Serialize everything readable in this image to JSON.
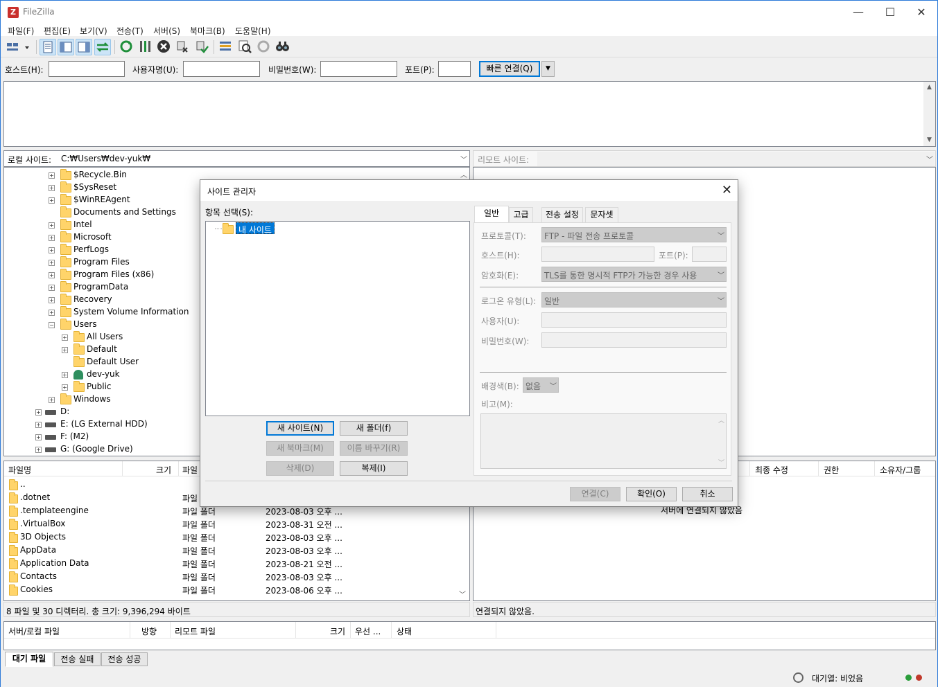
{
  "window": {
    "title": "FileZilla",
    "min": "—",
    "max": "☐",
    "close": "✕"
  },
  "menu": [
    "파일(F)",
    "편집(E)",
    "보기(V)",
    "전송(T)",
    "서버(S)",
    "북마크(B)",
    "도움말(H)"
  ],
  "quickconnect": {
    "host_label": "호스트(H):",
    "user_label": "사용자명(U):",
    "pass_label": "비밀번호(W):",
    "port_label": "포트(P):",
    "host_value": "",
    "user_value": "",
    "pass_value": "",
    "port_value": "",
    "connect_button": "빠른 연결(Q)"
  },
  "local": {
    "site_label": "로컬 사이트:",
    "path": "C:₩Users₩dev-yuk₩",
    "tree": [
      {
        "label": "$Recycle.Bin",
        "indent": 3,
        "exp": "+",
        "icon": "folder"
      },
      {
        "label": "$SysReset",
        "indent": 3,
        "exp": "+",
        "icon": "folder"
      },
      {
        "label": "$WinREAgent",
        "indent": 3,
        "exp": "+",
        "icon": "folder"
      },
      {
        "label": "Documents and Settings",
        "indent": 3,
        "exp": "",
        "icon": "folder"
      },
      {
        "label": "Intel",
        "indent": 3,
        "exp": "+",
        "icon": "folder"
      },
      {
        "label": "Microsoft",
        "indent": 3,
        "exp": "+",
        "icon": "folder"
      },
      {
        "label": "PerfLogs",
        "indent": 3,
        "exp": "+",
        "icon": "folder"
      },
      {
        "label": "Program Files",
        "indent": 3,
        "exp": "+",
        "icon": "folder"
      },
      {
        "label": "Program Files (x86)",
        "indent": 3,
        "exp": "+",
        "icon": "folder"
      },
      {
        "label": "ProgramData",
        "indent": 3,
        "exp": "+",
        "icon": "folder"
      },
      {
        "label": "Recovery",
        "indent": 3,
        "exp": "+",
        "icon": "folder"
      },
      {
        "label": "System Volume Information",
        "indent": 3,
        "exp": "+",
        "icon": "folder"
      },
      {
        "label": "Users",
        "indent": 3,
        "exp": "−",
        "icon": "folder"
      },
      {
        "label": "All Users",
        "indent": 4,
        "exp": "+",
        "icon": "folder"
      },
      {
        "label": "Default",
        "indent": 4,
        "exp": "+",
        "icon": "folder"
      },
      {
        "label": "Default User",
        "indent": 4,
        "exp": "",
        "icon": "folder"
      },
      {
        "label": "dev-yuk",
        "indent": 4,
        "exp": "+",
        "icon": "user"
      },
      {
        "label": "Public",
        "indent": 4,
        "exp": "+",
        "icon": "folder"
      },
      {
        "label": "Windows",
        "indent": 3,
        "exp": "+",
        "icon": "folder"
      },
      {
        "label": "D:",
        "indent": 2,
        "exp": "+",
        "icon": "drive"
      },
      {
        "label": "E: (LG External HDD)",
        "indent": 2,
        "exp": "+",
        "icon": "drive"
      },
      {
        "label": "F: (M2)",
        "indent": 2,
        "exp": "+",
        "icon": "drive"
      },
      {
        "label": "G: (Google Drive)",
        "indent": 2,
        "exp": "+",
        "icon": "drive"
      }
    ],
    "columns": {
      "name": "파일명",
      "size": "크기",
      "type": "파일"
    },
    "files": [
      {
        "name": "..",
        "type": "",
        "date": ""
      },
      {
        "name": ".dotnet",
        "type": "파일",
        "date": ""
      },
      {
        "name": ".templateengine",
        "type": "파일 폴더",
        "date": "2023-08-03 오후 ..."
      },
      {
        "name": ".VirtualBox",
        "type": "파일 폴더",
        "date": "2023-08-31 오전 ..."
      },
      {
        "name": "3D Objects",
        "type": "파일 폴더",
        "date": "2023-08-03 오후 ..."
      },
      {
        "name": "AppData",
        "type": "파일 폴더",
        "date": "2023-08-03 오후 ..."
      },
      {
        "name": "Application Data",
        "type": "파일 폴더",
        "date": "2023-08-21 오전 ..."
      },
      {
        "name": "Contacts",
        "type": "파일 폴더",
        "date": "2023-08-03 오후 ..."
      },
      {
        "name": "Cookies",
        "type": "파일 폴더",
        "date": "2023-08-06 오후 ..."
      }
    ],
    "status": "8 파일 및 30 디렉터리. 총 크기: 9,396,294 바이트"
  },
  "remote": {
    "site_label": "리모트 사이트:",
    "columns": {
      "modified": "최종 수정",
      "perms": "권한",
      "owner": "소유자/그룹"
    },
    "empty_msg": "서버에 연결되지 않았음",
    "status": "연결되지 않았음."
  },
  "queue": {
    "columns": {
      "server_local": "서버/로컬 파일",
      "direction": "방향",
      "remote": "리모트 파일",
      "size": "크기",
      "priority": "우선 ...",
      "state": "상태"
    },
    "tabs": [
      "대기 파일",
      "전송 실패",
      "전송 성공"
    ],
    "status": "대기열: 비었음"
  },
  "site_manager": {
    "title": "사이트 관리자",
    "select_label": "항목 선택(S):",
    "tree_root": "내 사이트",
    "buttons": {
      "new_site": "새 사이트(N)",
      "new_folder": "새 폴더(f)",
      "new_bookmark": "새 북마크(M)",
      "rename": "이름 바꾸기(R)",
      "delete": "삭제(D)",
      "duplicate": "복제(I)",
      "connect": "연결(C)",
      "ok": "확인(O)",
      "cancel": "취소"
    },
    "tabs": [
      "일반",
      "고급",
      "전송 설정",
      "문자셋"
    ],
    "general": {
      "protocol_label": "프로토콜(T):",
      "protocol_value": "FTP - 파일 전송 프로토콜",
      "host_label": "호스트(H):",
      "port_label": "포트(P):",
      "encryption_label": "암호화(E):",
      "encryption_value": "TLS를 통한 명시적 FTP가 가능한 경우 사용",
      "logon_label": "로그온 유형(L):",
      "logon_value": "일반",
      "user_label": "사용자(U):",
      "pass_label": "비밀번호(W):",
      "bg_label": "배경색(B):",
      "bg_value": "없음",
      "comment_label": "비고(M):"
    }
  }
}
